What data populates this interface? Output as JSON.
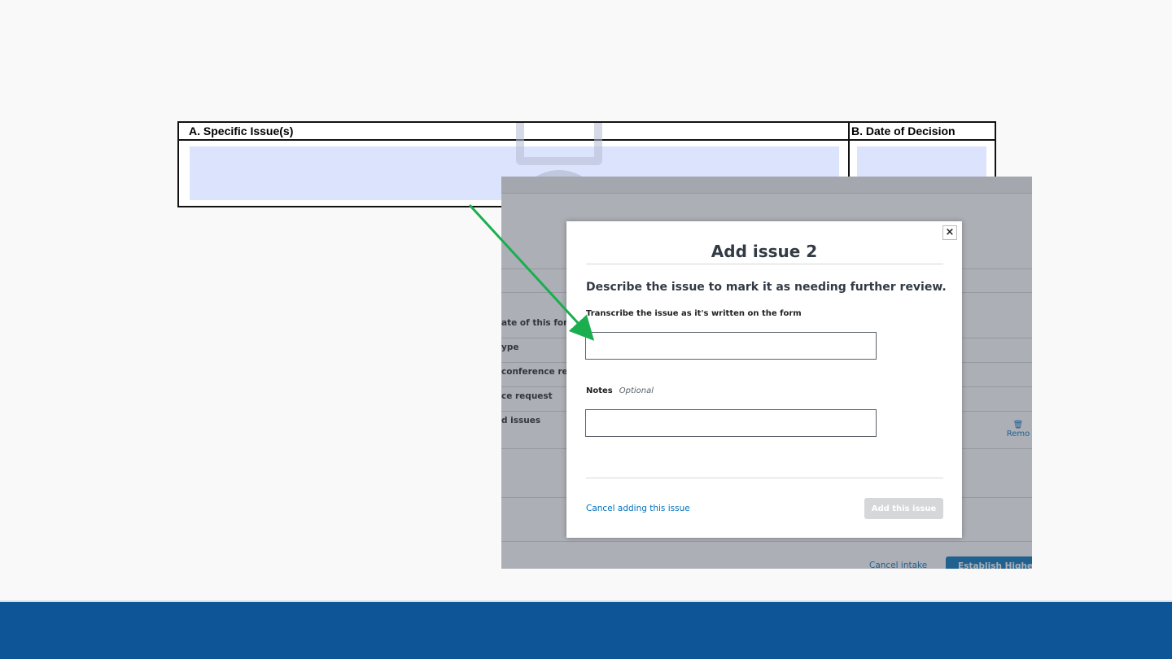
{
  "form": {
    "col_a_header": "A. Specific Issue(s)",
    "col_b_header": "B. Date of Decision"
  },
  "background_app": {
    "rows": [
      "ate of this form",
      "ype",
      "conference reque",
      "ce request",
      "d issues"
    ],
    "remove_label": "Remo",
    "cancel_intake": "Cancel intake",
    "establish_button": "Establish Higher-L"
  },
  "modal": {
    "title": "Add issue 2",
    "description": "Describe the issue to mark it as needing further review.",
    "transcribe_label": "Transcribe the issue as it's written on the form",
    "transcribe_value": "",
    "notes_label": "Notes",
    "notes_optional": "Optional",
    "notes_value": "",
    "cancel_link": "Cancel adding this issue",
    "add_button": "Add this issue",
    "close_icon": "×"
  },
  "colors": {
    "footer": "#0e5597",
    "field_highlight": "#dce3fd",
    "arrow": "#1aae4f",
    "link": "#0071bb",
    "disabled_button": "#d6d7d9"
  },
  "icons": {
    "close": "close-icon",
    "trash": "trash-icon"
  }
}
